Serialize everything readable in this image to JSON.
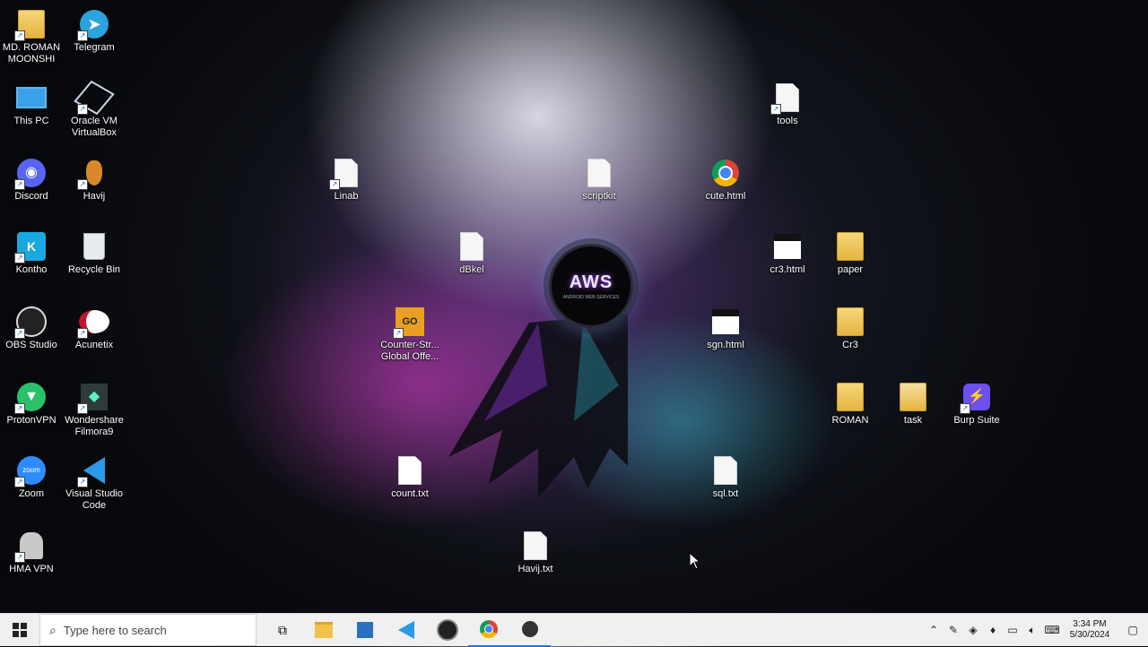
{
  "desktop": {
    "icons": [
      {
        "label": "MD. ROMAN MOONSHI",
        "icon": "folder-user-icon"
      },
      {
        "label": "Telegram",
        "icon": "telegram-icon"
      },
      {
        "label": "This PC",
        "icon": "computer-icon"
      },
      {
        "label": "Oracle VM VirtualBox",
        "icon": "virtualbox-icon"
      },
      {
        "label": "Discord",
        "icon": "discord-icon"
      },
      {
        "label": "Havij",
        "icon": "havij-icon"
      },
      {
        "label": "Kontho",
        "icon": "kontho-icon"
      },
      {
        "label": "Recycle Bin",
        "icon": "recycle-bin-icon"
      },
      {
        "label": "OBS Studio",
        "icon": "obs-icon"
      },
      {
        "label": "Acunetix",
        "icon": "acunetix-icon"
      },
      {
        "label": "ProtonVPN",
        "icon": "protonvpn-icon"
      },
      {
        "label": "Wondershare Filmora9",
        "icon": "filmora-icon"
      },
      {
        "label": "Zoom",
        "icon": "zoom-icon"
      },
      {
        "label": "Visual Studio Code",
        "icon": "vscode-icon"
      },
      {
        "label": "HMA VPN",
        "icon": "hma-vpn-icon"
      },
      {
        "label": "tools",
        "icon": "file-icon"
      },
      {
        "label": "Linab",
        "icon": "file-icon"
      },
      {
        "label": "scriptkit",
        "icon": "file-icon"
      },
      {
        "label": "cute.html",
        "icon": "chrome-icon"
      },
      {
        "label": "dBkel",
        "icon": "file-icon"
      },
      {
        "label": "cr3.html",
        "icon": "html-file-icon"
      },
      {
        "label": "paper",
        "icon": "folder-icon"
      },
      {
        "label": "Counter-Str... Global Offe...",
        "icon": "csgo-icon"
      },
      {
        "label": "sgn.html",
        "icon": "html-file-icon"
      },
      {
        "label": "Cr3",
        "icon": "folder-icon"
      },
      {
        "label": "ROMAN",
        "icon": "folder-icon"
      },
      {
        "label": "task",
        "icon": "folder-icon"
      },
      {
        "label": "Burp Suite",
        "icon": "burp-icon"
      },
      {
        "label": "count.txt",
        "icon": "file-icon"
      },
      {
        "label": "sql.txt",
        "icon": "file-icon"
      },
      {
        "label": "Havij.txt",
        "icon": "file-icon"
      }
    ],
    "logo_text": "AWS",
    "logo_sub": "ANDROID WEB SERVICES"
  },
  "taskbar": {
    "search_placeholder": "Type here to search",
    "apps": [
      "task-view-icon",
      "file-explorer-icon",
      "store-icon",
      "vscode-icon",
      "obs-icon",
      "chrome-icon",
      "obs-taskbar-icon"
    ],
    "clock_time": "3:34 PM",
    "clock_date": "5/30/2024"
  },
  "colors": {
    "taskbar_bg": "#f0f0f0",
    "accent": "#1a73e8"
  }
}
